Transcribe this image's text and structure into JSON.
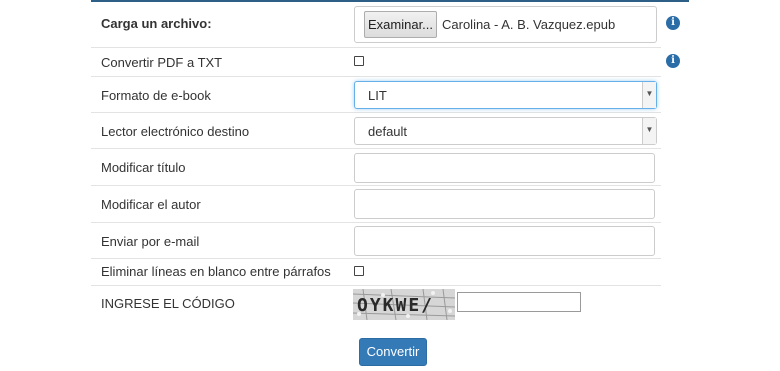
{
  "form": {
    "file": {
      "label": "Carga un archivo:",
      "button": "Examinar...",
      "filename": "Carolina - A. B. Vazquez.epub"
    },
    "pdf": {
      "label": "Convertir PDF a TXT",
      "checked": false
    },
    "format": {
      "label": "Formato de e-book",
      "selected": "LIT"
    },
    "reader": {
      "label": "Lector electrónico destino",
      "selected": "default"
    },
    "title": {
      "label": "Modificar título",
      "value": ""
    },
    "author": {
      "label": "Modificar el autor",
      "value": ""
    },
    "email": {
      "label": "Enviar por e-mail",
      "value": ""
    },
    "blanklines": {
      "label": "Eliminar líneas en blanco entre párrafos",
      "checked": false
    },
    "captcha": {
      "label": "INGRESE EL CÓDIGO",
      "image_text": "OYKWE/",
      "value": ""
    },
    "submit": "Convertir"
  },
  "colors": {
    "accent": "#337ab7",
    "info_icon": "#2b6da6",
    "top_border": "#2e5f86"
  }
}
